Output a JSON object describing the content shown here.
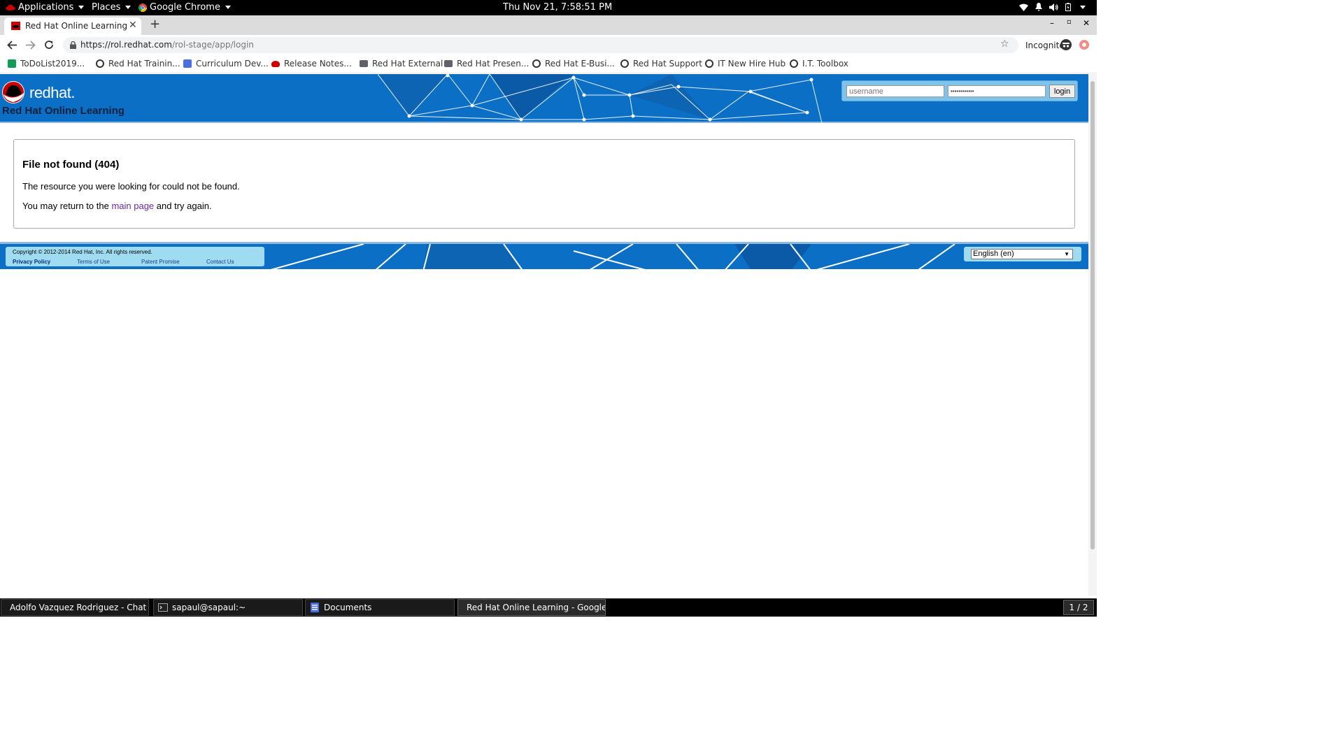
{
  "system_bar": {
    "applications": "Applications",
    "places": "Places",
    "active_app": "Google Chrome",
    "clock": "Thu Nov 21,  7:58:51 PM"
  },
  "browser": {
    "tab_title": "Red Hat Online Learning",
    "new_tab": "+",
    "url_host": "https://rol.redhat.com",
    "url_path": "/rol-stage/app/login",
    "incognito_label": "Incognito",
    "bookmarks": [
      {
        "label": "ToDoList2019...",
        "icon": "sheets-icon",
        "color": "#0f9d58"
      },
      {
        "label": "Red Hat Trainin...",
        "icon": "globe-icon",
        "color": "#333333"
      },
      {
        "label": "Curriculum Dev...",
        "icon": "docs-icon",
        "color": "#4a6ee0"
      },
      {
        "label": "Release Notes...",
        "icon": "redhat-icon",
        "color": "#cc0000"
      },
      {
        "label": "Red Hat External",
        "icon": "folder-icon",
        "color": "#5f6368"
      },
      {
        "label": "Red Hat Presen...",
        "icon": "folder-icon",
        "color": "#5f6368"
      },
      {
        "label": "Red Hat E-Busi...",
        "icon": "globe-icon",
        "color": "#333333"
      },
      {
        "label": "Red Hat Support",
        "icon": "globe-icon",
        "color": "#333333"
      },
      {
        "label": "IT New Hire Hub",
        "icon": "globe-icon",
        "color": "#333333"
      },
      {
        "label": "I.T. Toolbox",
        "icon": "globe-icon",
        "color": "#333333"
      }
    ]
  },
  "page": {
    "logo_text": "redhat.",
    "site_title": "Red Hat Online Learning",
    "login": {
      "username_placeholder": "username",
      "password_value": "••••••••••••",
      "button_label": "login"
    },
    "error": {
      "heading": "File not found (404)",
      "message": "The resource you were looking for could not be found.",
      "return_prefix": "You may return to the",
      "return_link": "main page",
      "return_suffix": "and try again."
    },
    "footer": {
      "copyright": "Copyright © 2012-2014 Red Hat, Inc. All rights reserved.",
      "links": [
        "Privacy Policy",
        "Terms of Use",
        "Patent Promise",
        "Contact Us"
      ],
      "language": "English (en)"
    },
    "colors": {
      "brand_blue": "#0a6fc5",
      "brand_red": "#cc0000",
      "link_purple": "#6a2a9a"
    }
  },
  "taskbar": {
    "tasks": [
      "Adolfo Vazquez Rodriguez - Chat ...",
      "sapaul@sapaul:~",
      "Documents",
      "Red Hat Online Learning - Google ..."
    ],
    "workspace": "1 / 2"
  }
}
